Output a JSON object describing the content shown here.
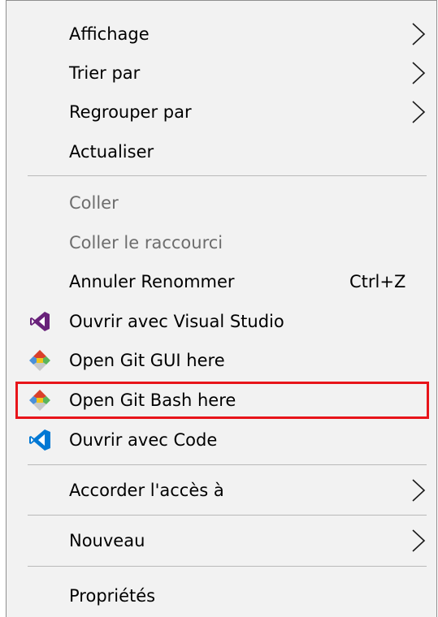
{
  "menu": {
    "items": [
      {
        "label": "Affichage",
        "submenu": true
      },
      {
        "label": "Trier par",
        "submenu": true
      },
      {
        "label": "Regrouper par",
        "submenu": true
      },
      {
        "label": "Actualiser"
      },
      {
        "label": "Coller",
        "disabled": true
      },
      {
        "label": "Coller le raccourci",
        "disabled": true
      },
      {
        "label": "Annuler Renommer",
        "shortcut": "Ctrl+Z"
      },
      {
        "label": "Ouvrir avec Visual Studio",
        "icon": "visual-studio-icon"
      },
      {
        "label": "Open Git GUI here",
        "icon": "git-icon"
      },
      {
        "label": "Open Git Bash here",
        "icon": "git-icon",
        "highlighted": true
      },
      {
        "label": "Ouvrir avec Code",
        "icon": "vscode-icon"
      },
      {
        "label": "Accorder l'accès à",
        "submenu": true
      },
      {
        "label": "Nouveau",
        "submenu": true
      },
      {
        "label": "Propriétés"
      }
    ]
  },
  "colors": {
    "menu_background": "#f2f2f2",
    "disabled_text": "#6d6d6d",
    "highlight_border": "#e8141a",
    "visual_studio": "#68217a",
    "vscode": "#0078d4"
  }
}
